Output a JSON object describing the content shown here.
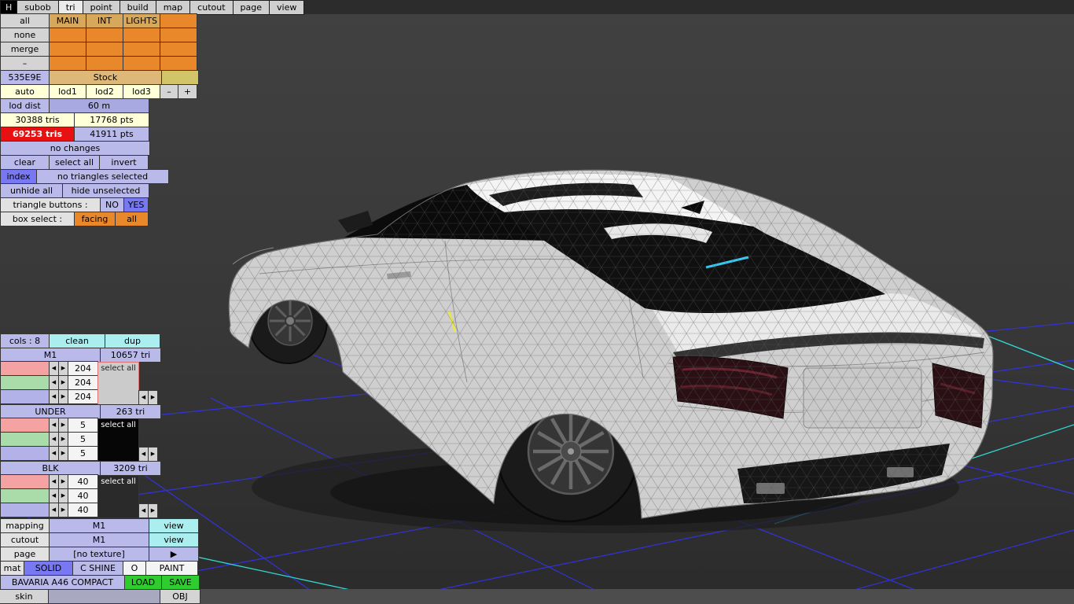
{
  "colors": {
    "accent_lavender": "#b9b9ea",
    "accent_blue": "#7878f2",
    "accent_orange": "#e8882a",
    "accent_tan": "#d8a85a",
    "accent_yellow": "#ffffd8",
    "accent_red": "#e81010",
    "accent_green": "#2ecc2e",
    "accent_cyan": "#aaeef0",
    "grid_blue": "#3232e0",
    "grid_cyan": "#30d8d0"
  },
  "menu": {
    "h": "H",
    "items": [
      "subob",
      "tri",
      "point",
      "build",
      "map",
      "cutout",
      "page",
      "view"
    ],
    "active": "tri"
  },
  "object_panel": {
    "side_buttons": [
      "all",
      "none",
      "merge",
      "–"
    ],
    "grid_headers": [
      "MAIN",
      "INT",
      "LIGHTS"
    ],
    "object_id": "535E9E",
    "object_name": "Stock",
    "lod_auto": "auto",
    "lods": [
      "lod1",
      "lod2",
      "lod3"
    ],
    "lod_minus": "–",
    "lod_plus": "+",
    "lod_dist_label": "lod dist",
    "lod_dist_value": "60 m",
    "lod_tris": "30388 tris",
    "lod_pts": "17768 pts",
    "total_tris": "69253 tris",
    "total_pts": "41911 pts",
    "changes_status": "no changes",
    "clear": "clear",
    "select_all": "select all",
    "invert": "invert",
    "index": "index",
    "selection_status": "no triangles selected",
    "unhide_all": "unhide all",
    "hide_unselected": "hide unselected",
    "triangle_buttons_label": "triangle buttons :",
    "no": "NO",
    "yes": "YES",
    "box_select_label": "box select :",
    "facing": "facing",
    "all": "all"
  },
  "materials_panel": {
    "cols_label": "cols : 8",
    "clean": "clean",
    "dup": "dup",
    "select_all": "select all",
    "arrow_left": "◀",
    "arrow_right": "▶",
    "materials": [
      {
        "name": "M1",
        "tris": "10657 tri",
        "r": "204",
        "g": "204",
        "b": "204"
      },
      {
        "name": "UNDER",
        "tris": "263 tri",
        "r": "5",
        "g": "5",
        "b": "5"
      },
      {
        "name": "BLK",
        "tris": "3209 tri",
        "r": "40",
        "g": "40",
        "b": "40"
      }
    ]
  },
  "surface_panel": {
    "mapping_label": "mapping",
    "mapping_value": "M1",
    "view": "view",
    "cutout_label": "cutout",
    "cutout_value": "M1",
    "page_label": "page",
    "page_value": "[no texture]",
    "page_next": "▶",
    "mat_label": "mat",
    "solid": "SOLID",
    "c_shine": "C SHINE",
    "o": "O",
    "paint": "PAINT",
    "model_name": "BAVARIA A46 COMPACT",
    "load": "LOAD",
    "save": "SAVE"
  },
  "status_bar": {
    "skin": "skin",
    "obj": "OBJ"
  }
}
